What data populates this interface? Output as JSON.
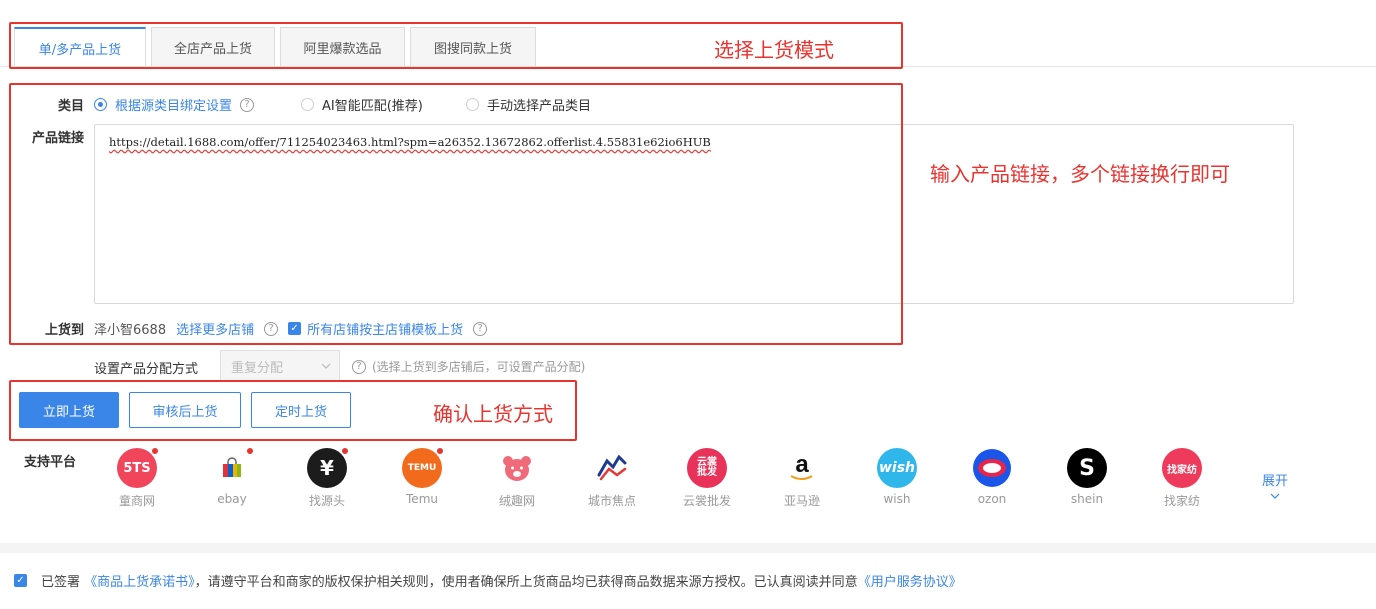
{
  "tabs": [
    {
      "label": "单/多产品上货",
      "active": true
    },
    {
      "label": "全店产品上货",
      "active": false
    },
    {
      "label": "阿里爆款选品",
      "active": false
    },
    {
      "label": "图搜同款上货",
      "active": false
    }
  ],
  "annotations": {
    "mode": "选择上货模式",
    "link": "输入产品链接，多个链接换行即可",
    "confirm": "确认上货方式"
  },
  "category": {
    "label": "类目",
    "options": [
      {
        "label": "根据源类目绑定设置",
        "selected": true
      },
      {
        "label": "AI智能匹配(推荐)",
        "selected": false
      },
      {
        "label": "手动选择产品类目",
        "selected": false
      }
    ]
  },
  "product_link": {
    "label": "产品链接",
    "value": "https://detail.1688.com/offer/711254023463.html?spm=a26352.13672862.offerlist.4.55831e62io6HUB"
  },
  "upload_to": {
    "label": "上货到",
    "store": "泽小智6688",
    "more_stores": "选择更多店铺",
    "template_checkbox": "所有店铺按主店铺模板上货"
  },
  "distribution": {
    "label": "设置产品分配方式",
    "select_value": "重复分配",
    "hint": "(选择上货到多店铺后，可设置产品分配)"
  },
  "buttons": {
    "now": "立即上货",
    "review": "审核后上货",
    "scheduled": "定时上货"
  },
  "platforms": {
    "label": "支持平台",
    "expand": "展开",
    "items": [
      {
        "name": "童商网",
        "logo": "5TS",
        "color": "#f0455b",
        "dot": true
      },
      {
        "name": "ebay",
        "logo": "bag",
        "color": "#ffffff",
        "dot": true
      },
      {
        "name": "找源头",
        "logo": "¥",
        "color": "#1c1c1c",
        "dot": true
      },
      {
        "name": "Temu",
        "logo": "TEMU",
        "color": "#f26b1d",
        "dot": true
      },
      {
        "name": "绒趣网",
        "logo": "bear",
        "color": "#ffffff",
        "dot": false
      },
      {
        "name": "城市焦点",
        "logo": "horse",
        "color": "#ffffff",
        "dot": false
      },
      {
        "name": "云裳批发",
        "logo": "云裳批发",
        "color": "#e8325a",
        "dot": false
      },
      {
        "name": "亚马逊",
        "logo": "a",
        "color": "#ffffff",
        "dot": false
      },
      {
        "name": "wish",
        "logo": "wish",
        "color": "#2fb7ec",
        "dot": false
      },
      {
        "name": "ozon",
        "logo": "ozon",
        "color": "#ffffff",
        "dot": false
      },
      {
        "name": "shein",
        "logo": "S",
        "color": "#000000",
        "dot": false
      },
      {
        "name": "找家纺",
        "logo": "找家纺",
        "color": "#ee3b5b",
        "dot": false
      }
    ]
  },
  "agreement": {
    "prefix": "已签署",
    "doc1": "《商品上货承诺书》",
    "middle": "，请遵守平台和商家的版权保护相关规则，使用者确保所上货商品均已获得商品数据来源方授权。已认真阅读并同意",
    "doc2": "《用户服务协议》"
  }
}
